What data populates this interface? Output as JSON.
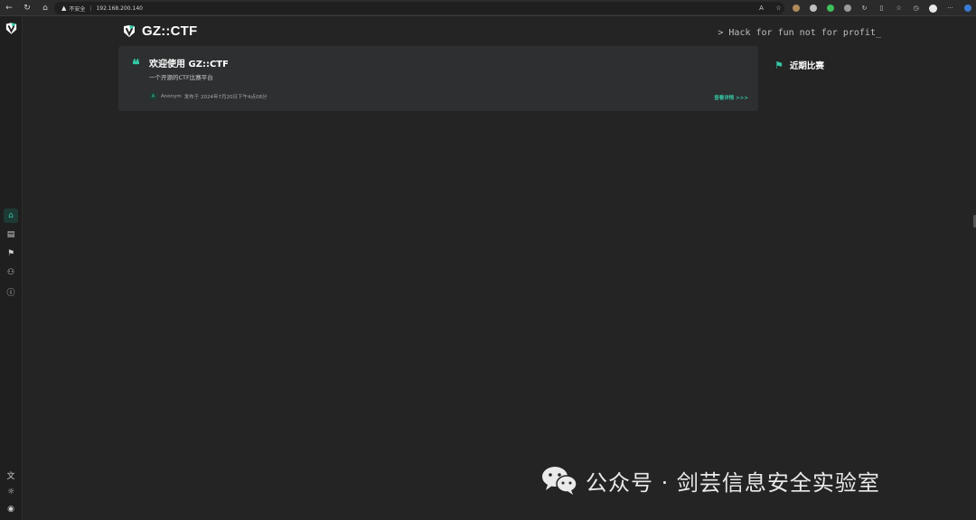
{
  "browser": {
    "address_warning": "不安全",
    "url": "192.168.200.140"
  },
  "sidebar": {
    "items": [
      {
        "name": "home",
        "icon": "home-icon",
        "active": true
      },
      {
        "name": "posts",
        "icon": "file-icon",
        "active": false
      },
      {
        "name": "games",
        "icon": "flag-icon",
        "active": false
      },
      {
        "name": "teams",
        "icon": "users-icon",
        "active": false
      },
      {
        "name": "about",
        "icon": "info-icon",
        "active": false
      }
    ],
    "bottom": [
      {
        "name": "language",
        "icon": "translate-icon"
      },
      {
        "name": "theme",
        "icon": "sun-icon"
      },
      {
        "name": "user",
        "icon": "user-circle-icon"
      }
    ]
  },
  "header": {
    "brand": "GZ::CTF",
    "slogan": "> Hack for fun not for profit_"
  },
  "post": {
    "title": "欢迎使用 GZ::CTF",
    "summary": "一个开源的CTF比赛平台",
    "author": "Anonym",
    "meta": "发布于 2024年7月20日下午4点08分",
    "more": "查看详情 >>>"
  },
  "recent": {
    "label": "近期比赛"
  },
  "watermark": {
    "text": "公众号 · 剑芸信息安全实验室"
  },
  "colors": {
    "accent": "#35c7a6",
    "background": "#242424",
    "card": "#2d2f30"
  }
}
